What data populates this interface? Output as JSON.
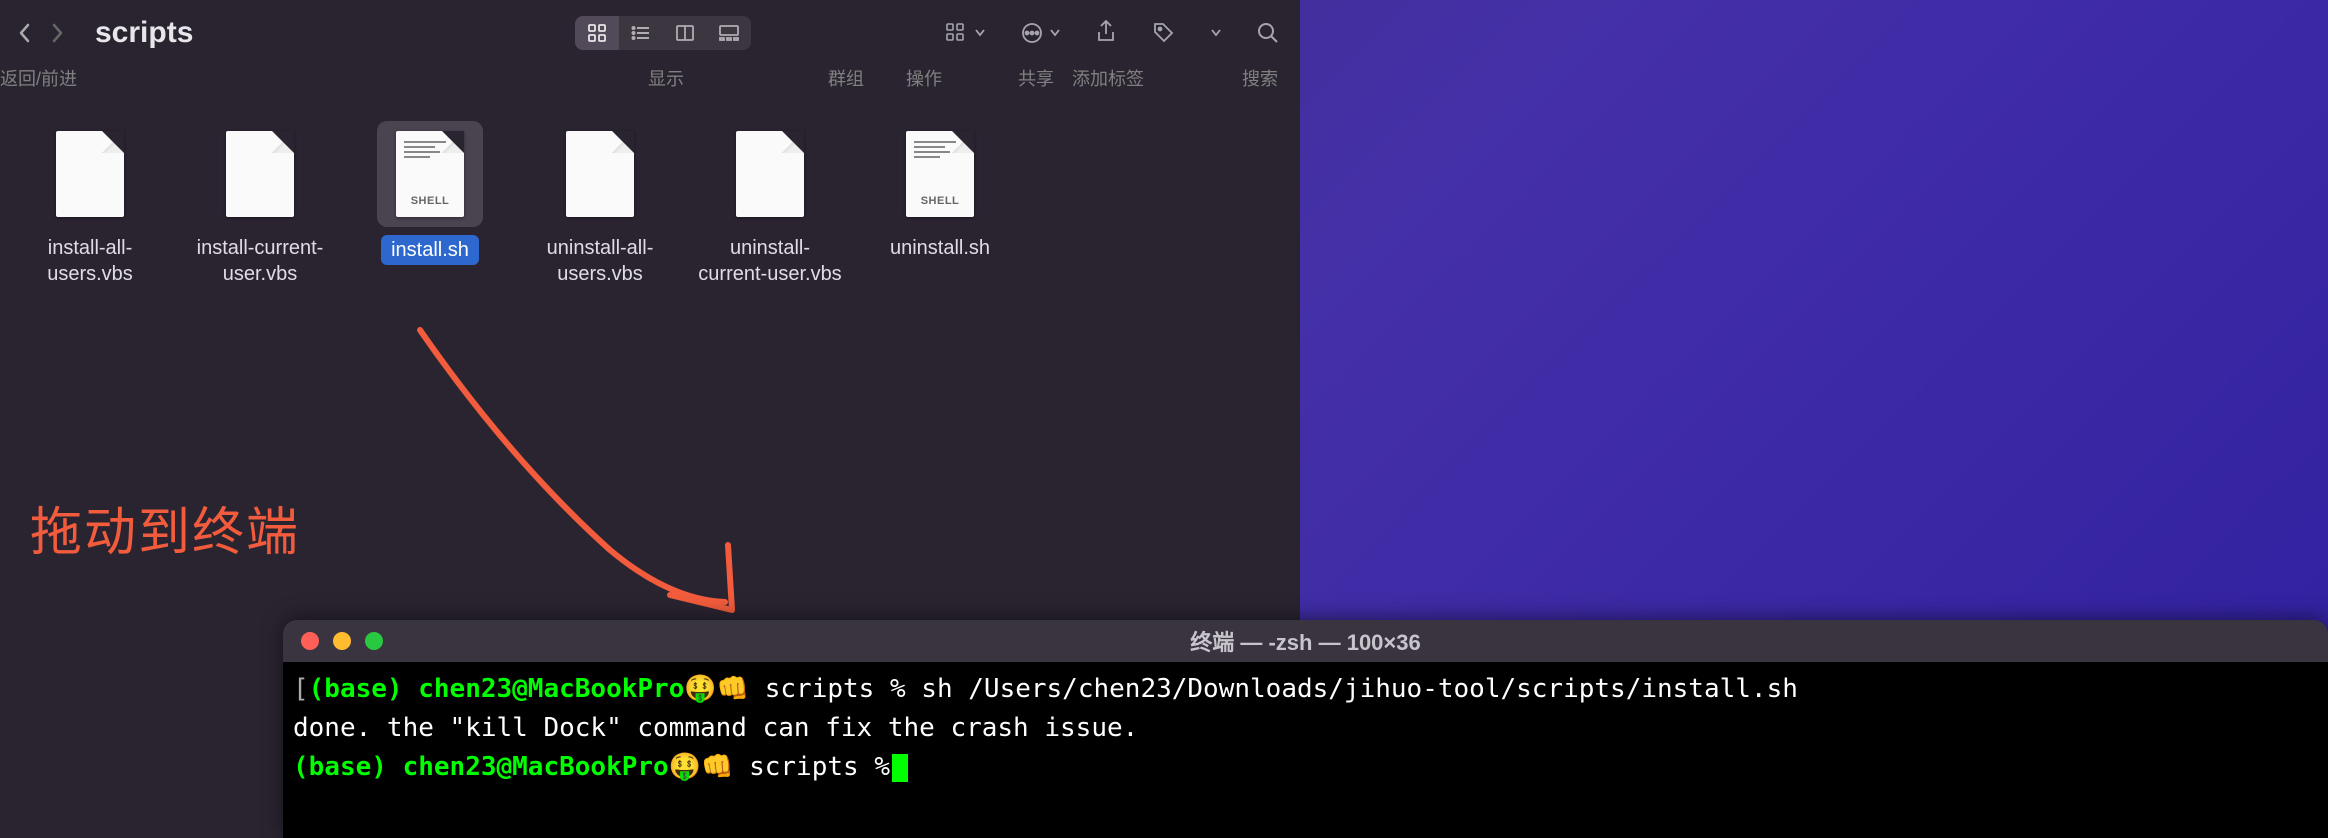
{
  "finder": {
    "title": "scripts",
    "nav_label": "返回/前进",
    "sublabels": {
      "display": "显示",
      "group": "群组",
      "action": "操作",
      "share": "共享",
      "tags": "添加标签",
      "search": "搜索"
    },
    "files": [
      {
        "name": "install-all-users.vbs",
        "type": "plain",
        "selected": false
      },
      {
        "name": "install-current-user.vbs",
        "type": "plain",
        "selected": false
      },
      {
        "name": "install.sh",
        "type": "shell",
        "selected": true
      },
      {
        "name": "uninstall-all-users.vbs",
        "type": "plain",
        "selected": false
      },
      {
        "name": "uninstall-current-user.vbs",
        "type": "plain",
        "selected": false
      },
      {
        "name": "uninstall.sh",
        "type": "shell",
        "selected": false
      }
    ],
    "shell_tag": "SHELL"
  },
  "annotation": {
    "text": "拖动到终端"
  },
  "terminal": {
    "title": "终端 — -zsh — 100×36",
    "prompt_env": "(base)",
    "prompt_userhost": "chen23@MacBookPro🤑👊",
    "prompt_dir": "scripts",
    "prompt_sym": "%",
    "command": "sh /Users/chen23/Downloads/jihuo-tool/scripts/install.sh",
    "output": "done. the \"kill Dock\" command can fix the crash issue."
  }
}
